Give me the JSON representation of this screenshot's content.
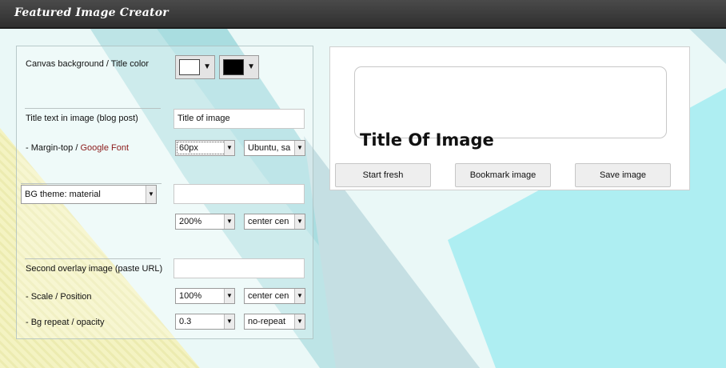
{
  "header": {
    "app_title": "Featured Image Creator"
  },
  "settings": {
    "canvas_label": "Canvas background / Title color",
    "canvas_bg_color": "#ffffff",
    "title_color": "#000000",
    "title_text_label": "Title text in image (blog post)",
    "title_text_value": "Title of image",
    "margin_label_prefix": "- Margin-top / ",
    "google_font_link": "Google Font",
    "margin_top_value": "60px",
    "font_value": "Ubuntu, sa",
    "bg_theme_value": "BG theme: material",
    "bg_url_value": "",
    "bg_scale_value": "200%",
    "bg_position_value": "center cen",
    "overlay_label": "Second overlay image (paste URL)",
    "overlay_url_value": "",
    "scale_position_label": "- Scale / Position",
    "overlay_scale_value": "100%",
    "overlay_position_value": "center cen",
    "repeat_opacity_label": "- Bg repeat / opacity",
    "opacity_value": "0.3",
    "repeat_value": "no-repeat"
  },
  "preview": {
    "title_text": "Title Of Image",
    "start_fresh_label": "Start fresh",
    "bookmark_label": "Bookmark image",
    "save_label": "Save image"
  },
  "icons": {
    "dropdown": "▼"
  },
  "colors": {
    "topbar": "#333333",
    "background": "#eaf8f7",
    "google_font_link": "#8b1a1a"
  }
}
